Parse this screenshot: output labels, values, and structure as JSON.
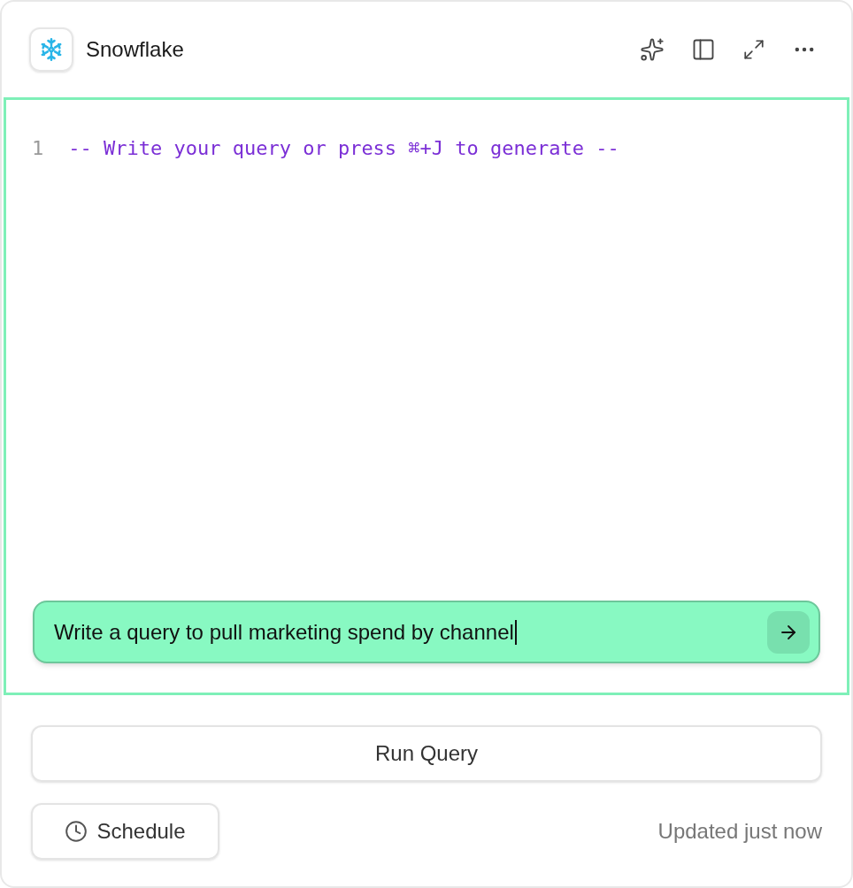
{
  "header": {
    "title": "Snowflake"
  },
  "editor": {
    "lines": [
      {
        "number": "1",
        "text": "-- Write your query or press ⌘+J to generate --"
      }
    ]
  },
  "prompt": {
    "value": "Write a query to pull marketing spend by channel",
    "focused": true
  },
  "run_button": "Run Query",
  "schedule_button": "Schedule",
  "status": "Updated just now"
}
